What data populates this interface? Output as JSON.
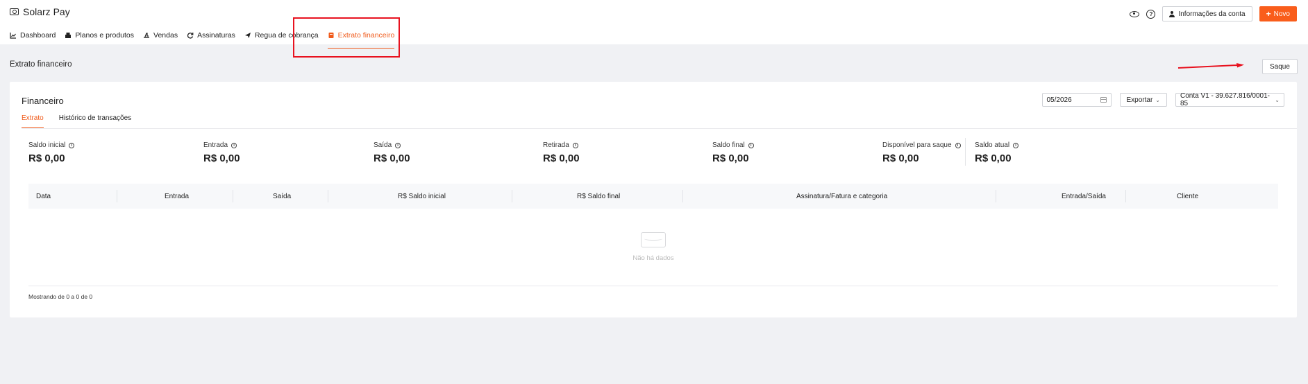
{
  "app": {
    "title": "Solarz Pay"
  },
  "nav": [
    {
      "label": "Dashboard",
      "icon": "chart-icon"
    },
    {
      "label": "Planos e produtos",
      "icon": "box-icon"
    },
    {
      "label": "Vendas",
      "icon": "sales-icon"
    },
    {
      "label": "Assinaturas",
      "icon": "refresh-icon"
    },
    {
      "label": "Regua de cobrança",
      "icon": "send-icon"
    },
    {
      "label": "Extrato financeiro",
      "icon": "book-icon",
      "active": true
    }
  ],
  "header": {
    "account_info_label": "Informações da conta",
    "new_label": "Novo"
  },
  "page": {
    "title": "Extrato financeiro",
    "saque_label": "Saque"
  },
  "card": {
    "title": "Financeiro",
    "tabs": [
      "Extrato",
      "Histórico de transações"
    ],
    "date_value": "05/2026",
    "export_label": "Exportar",
    "account_value": "Conta V1 - 39.627.816/0001-85"
  },
  "stats": [
    {
      "label": "Saldo inicial",
      "value": "R$ 0,00"
    },
    {
      "label": "Entrada",
      "value": "R$ 0,00"
    },
    {
      "label": "Saída",
      "value": "R$ 0,00"
    },
    {
      "label": "Retirada",
      "value": "R$ 0,00"
    },
    {
      "label": "Saldo final",
      "value": "R$ 0,00"
    },
    {
      "label": "Disponível para saque",
      "value": "R$ 0,00"
    },
    {
      "label": "Saldo atual",
      "value": "R$ 0,00"
    }
  ],
  "table": {
    "columns": [
      "Data",
      "Entrada",
      "Saída",
      "R$ Saldo inicial",
      "R$ Saldo final",
      "Assinatura/Fatura e categoria",
      "Entrada/Saída",
      "Cliente"
    ],
    "empty_text": "Não há dados",
    "footer": "Mostrando de 0 a 0 de 0"
  },
  "colors": {
    "accent": "#f95d1b",
    "highlight": "#e8121f"
  }
}
